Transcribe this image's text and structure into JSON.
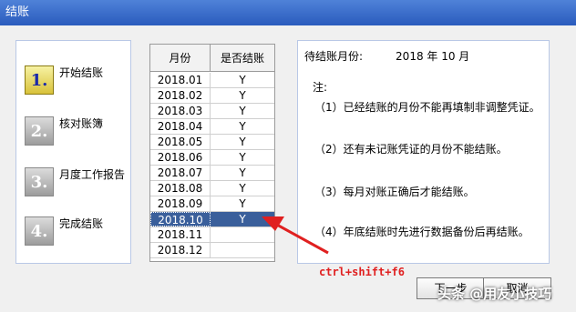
{
  "window": {
    "title": "结账"
  },
  "steps": [
    {
      "badge": "1.",
      "label": "开始结账",
      "active": true
    },
    {
      "badge": "2.",
      "label": "核对账簿",
      "active": false
    },
    {
      "badge": "3.",
      "label": "月度工作报告",
      "active": false
    },
    {
      "badge": "4.",
      "label": "完成结账",
      "active": false
    }
  ],
  "table": {
    "headers": [
      "月份",
      "是否结账"
    ],
    "rows": [
      [
        "2018.01",
        "Y"
      ],
      [
        "2018.02",
        "Y"
      ],
      [
        "2018.03",
        "Y"
      ],
      [
        "2018.04",
        "Y"
      ],
      [
        "2018.05",
        "Y"
      ],
      [
        "2018.06",
        "Y"
      ],
      [
        "2018.07",
        "Y"
      ],
      [
        "2018.08",
        "Y"
      ],
      [
        "2018.09",
        "Y"
      ],
      [
        "2018.10",
        "Y"
      ],
      [
        "2018.11",
        ""
      ],
      [
        "2018.12",
        ""
      ]
    ],
    "selected_row": 9
  },
  "info": {
    "pending_label": "待结账月份:",
    "pending_value": "2018 年 10 月",
    "notes_title": "注:",
    "notes": [
      "（1）已经结账的月份不能再填制非调整凭证。",
      "（2）还有未记账凭证的月份不能结账。",
      "（3）每月对账正确后才能结账。",
      "（4）年底结账时先进行数据备份后再结账。"
    ]
  },
  "annotation": {
    "text": "ctrl+shift+f6",
    "color": "#e02020"
  },
  "buttons": {
    "next": "下一步",
    "cancel": "取消"
  },
  "watermark": "头条 @用友小技巧",
  "colors": {
    "titlebar": "#2a5bbd",
    "selection": "#3a5f9b",
    "annotation": "#e02020"
  }
}
